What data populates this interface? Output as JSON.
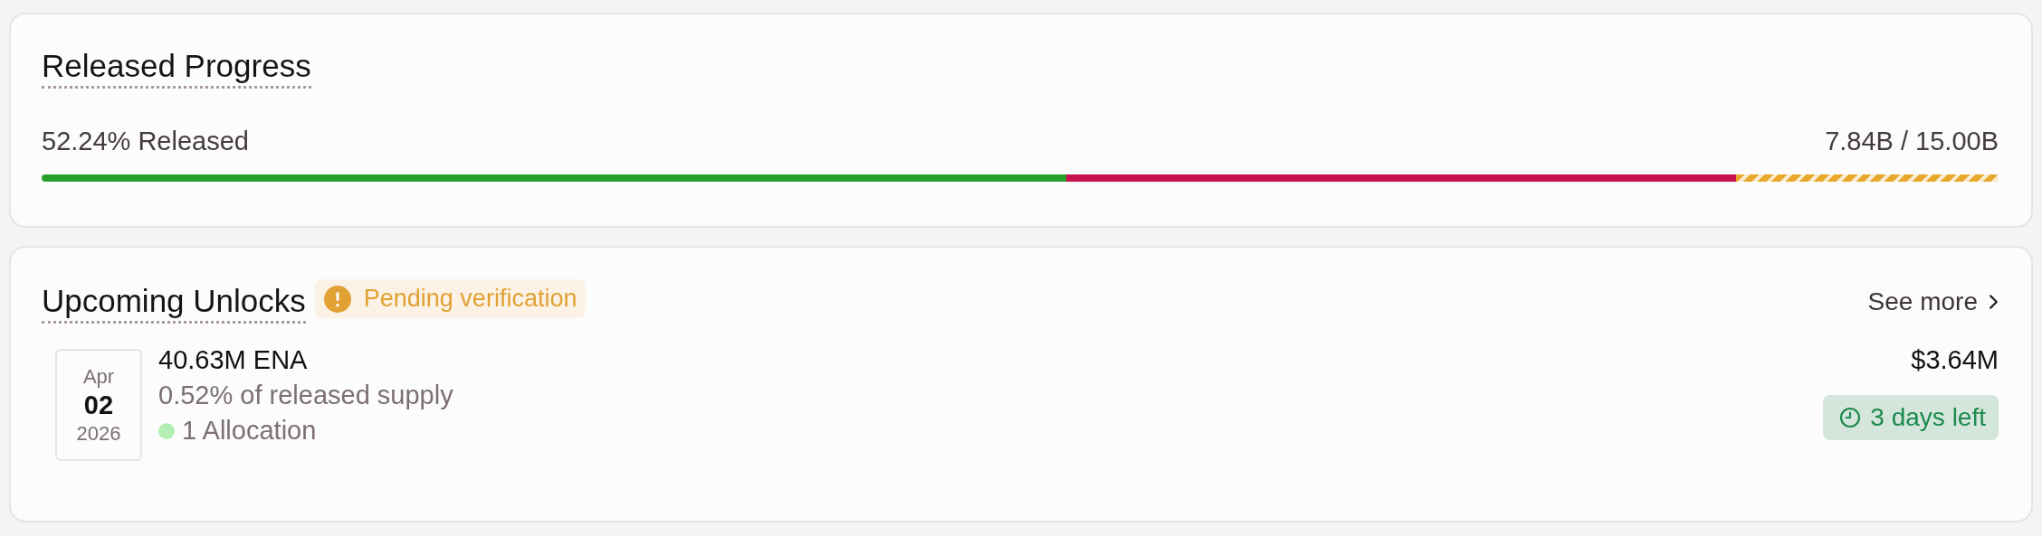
{
  "released_progress": {
    "title": "Released Progress",
    "released_label": "52.24% Released",
    "amount": "7.84B / 15.00B",
    "segments": [
      {
        "kind": "solid",
        "color": "#27a02b"
      },
      {
        "kind": "solid",
        "color": "#c4114f"
      },
      {
        "kind": "striped",
        "color": "#e8a82b"
      }
    ]
  },
  "upcoming_unlocks": {
    "title": "Upcoming Unlocks",
    "badge": "Pending verification",
    "see_more": "See more",
    "items": [
      {
        "month": "Apr",
        "day": "02",
        "year": "2026",
        "amount": "40.63M ENA",
        "share": "0.52% of released supply",
        "allocation": "1 Allocation",
        "color": "#b3efb5",
        "value": "$3.64M",
        "time_left": "3 days left"
      }
    ]
  }
}
